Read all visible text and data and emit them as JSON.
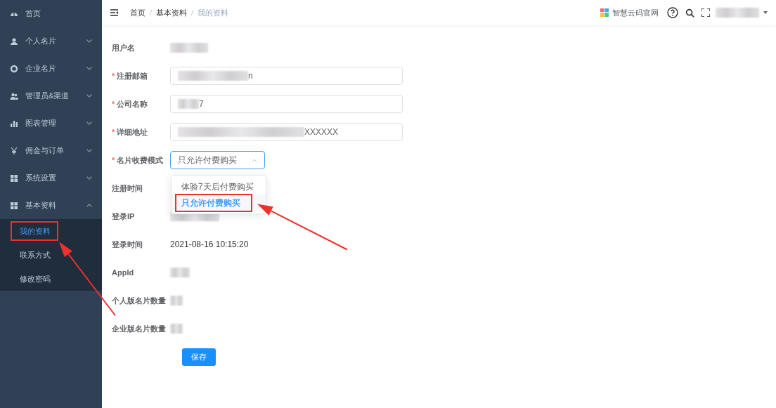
{
  "sidebar": {
    "items": [
      {
        "label": "首页",
        "kind": "link"
      },
      {
        "label": "个人名片",
        "kind": "menu",
        "expanded": false
      },
      {
        "label": "企业名片",
        "kind": "menu",
        "expanded": false
      },
      {
        "label": "管理员&渠道",
        "kind": "menu",
        "expanded": false
      },
      {
        "label": "图表管理",
        "kind": "menu",
        "expanded": false
      },
      {
        "label": "佣金与订单",
        "kind": "menu",
        "expanded": false
      },
      {
        "label": "系统设置",
        "kind": "menu",
        "expanded": false
      },
      {
        "label": "基本资料",
        "kind": "menu",
        "expanded": true,
        "children": [
          {
            "label": "我的资料",
            "selected": true,
            "highlighted": true
          },
          {
            "label": "联系方式",
            "selected": false,
            "highlighted": false
          },
          {
            "label": "修改密码",
            "selected": false,
            "highlighted": false
          }
        ]
      }
    ]
  },
  "header": {
    "breadcrumb": [
      "首页",
      "基本资料",
      "我的资料"
    ],
    "breadcrumb_separator": "/",
    "site_link": "智慧云码官网",
    "user": {
      "redacted": true
    }
  },
  "form": {
    "required_mark": "*",
    "fields": [
      {
        "label": "用户名",
        "kind": "text",
        "required": false,
        "redacted": true
      },
      {
        "label": "注册邮箱",
        "kind": "input",
        "required": true,
        "redacted": true,
        "value": "n"
      },
      {
        "label": "公司名称",
        "kind": "input",
        "required": true,
        "redacted": true,
        "value": "7"
      },
      {
        "label": "详细地址",
        "kind": "input",
        "required": true,
        "redacted": true,
        "value": "XXXXXX"
      },
      {
        "label": "名片收费模式",
        "kind": "select",
        "required": true,
        "value": "只允许付费购买",
        "open": true,
        "options": [
          {
            "label": "体验7天后付费购买",
            "selected": false,
            "highlighted": false
          },
          {
            "label": "只允许付费购买",
            "selected": true,
            "highlighted": true
          }
        ]
      },
      {
        "label": "注册时间",
        "kind": "text",
        "required": false
      },
      {
        "label": "登录IP",
        "kind": "text",
        "required": false,
        "redacted": true
      },
      {
        "label": "登录时间",
        "kind": "text",
        "required": false,
        "value": "2021-08-16 10:15:20"
      },
      {
        "label": "AppId",
        "kind": "text",
        "required": false,
        "redacted": true
      },
      {
        "label": "个人版名片数量",
        "kind": "text",
        "required": false,
        "redacted": true
      },
      {
        "label": "企业版名片数量",
        "kind": "text",
        "required": false,
        "redacted": true
      }
    ],
    "submit": "保存"
  }
}
